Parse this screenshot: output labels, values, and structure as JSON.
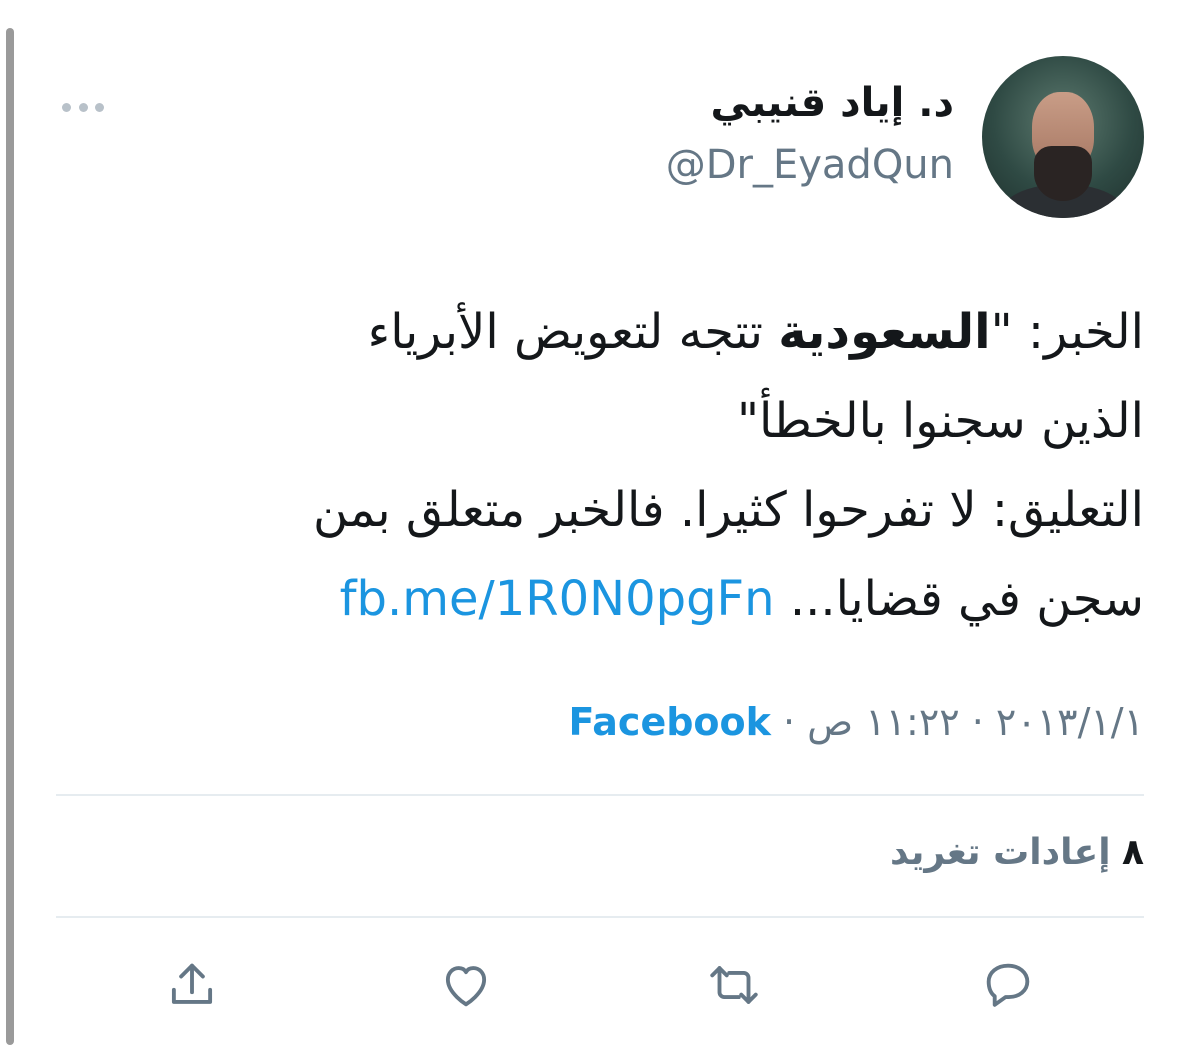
{
  "tweet": {
    "display_name": "د. إياد قنيبي",
    "handle": "@Dr_EyadQun",
    "text_lines": {
      "l1_a": "الخبر: \"",
      "l1_bold": "السعودية",
      "l1_b": " تتجه لتعويض الأبرياء",
      "l2": "الذين سجنوا بالخطأ\"",
      "l3": "التعليق: لا تفرحوا كثيرا. فالخبر متعلق بمن",
      "l4": "سجن في قضايا... ",
      "link": "fb.me/1R0N0pgFn"
    },
    "date": "٢٠١٣/١/١",
    "time": "١١:٢٢ ص",
    "source": "Facebook",
    "retweet_count": "٨",
    "retweet_label": "إعادات تغريد"
  },
  "icons": {
    "more": "more-dots-icon",
    "reply": "reply-bubble-icon",
    "retweet": "retweet-icon",
    "like": "heart-icon",
    "share": "share-upload-icon"
  },
  "colors": {
    "link": "#1b95e0",
    "secondary_text": "#657786",
    "icon": "#657786",
    "divider": "#e6ecf0"
  }
}
